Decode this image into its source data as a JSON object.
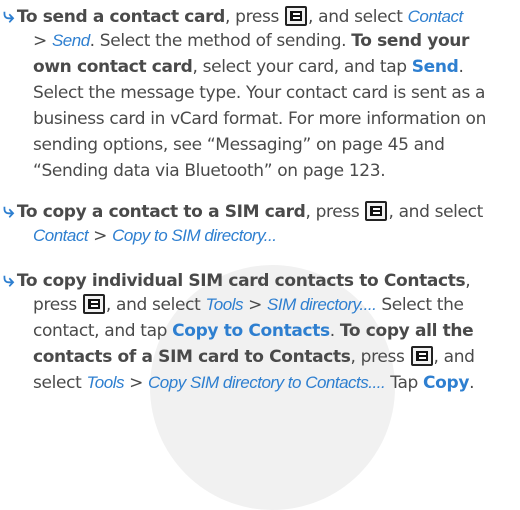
{
  "para1": {
    "t1": "To send a contact card",
    "t2": ", press",
    "t3": ", and select",
    "t4": "Contact",
    "t5": ">",
    "t6": "Send",
    "t7": ". Select the method of sending.",
    "t8": "To send your",
    "t9": "own contact card",
    "t10": ", select your card, and tap",
    "t11": "Send",
    "t12": ".",
    "t13": "Select the message type. Your contact card is sent as a",
    "t14": "business card in vCard format. For more information on",
    "t15": "sending options, see “Messaging” on page 45 and",
    "t16": "“Sending data via Bluetooth” on page 123."
  },
  "para2": {
    "t1": "To copy a contact to a SIM card",
    "t2": ", press",
    "t3": ", and select",
    "t4": "Contact",
    "t5": ">",
    "t6": "Copy to SIM directory..."
  },
  "para3": {
    "t1": "To copy individual SIM card contacts to Contacts",
    "t2": ",",
    "t3": "press",
    "t4": ", and select",
    "t5": "Tools",
    "t6": ">",
    "t7": "SIM directory....",
    "t8": "Select the",
    "t9": "contact, and tap",
    "t10": "Copy to Contacts",
    "t11": ".",
    "t12": "To copy all the",
    "t13": "contacts of a SIM card to Contacts",
    "t14": ", press",
    "t15": ", and",
    "t16": "select",
    "t17": "Tools",
    "t18": ">",
    "t19": "Copy SIM directory to Contacts....",
    "t20": "Tap",
    "t21": "Copy",
    "t22": "."
  },
  "icons": {
    "arrow": "arrow-right-icon",
    "menu_key": "menu-key-icon"
  },
  "colors": {
    "accent": "#2e7fd0",
    "text": "#4a4a4a",
    "watermark": "#f1f1f1"
  }
}
